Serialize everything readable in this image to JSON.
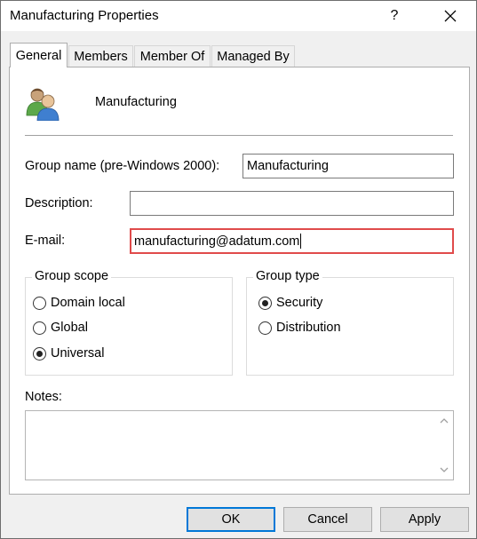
{
  "window": {
    "title": "Manufacturing Properties",
    "help_label": "?"
  },
  "tabs": [
    {
      "label": "General",
      "active": true
    },
    {
      "label": "Members",
      "active": false
    },
    {
      "label": "Member Of",
      "active": false
    },
    {
      "label": "Managed By",
      "active": false
    }
  ],
  "general": {
    "group_display_name": "Manufacturing",
    "group_icon": "group-users-icon",
    "group_name_label": "Group name (pre-Windows 2000):",
    "group_name_value": "Manufacturing",
    "description_label": "Description:",
    "description_value": "",
    "email_label": "E-mail:",
    "email_value": "manufacturing@adatum.com",
    "group_scope": {
      "title": "Group scope",
      "options": [
        "Domain local",
        "Global",
        "Universal"
      ],
      "selected": "Universal"
    },
    "group_type": {
      "title": "Group type",
      "options": [
        "Security",
        "Distribution"
      ],
      "selected": "Security"
    },
    "notes_label": "Notes:",
    "notes_value": ""
  },
  "buttons": {
    "ok": "OK",
    "cancel": "Cancel",
    "apply": "Apply"
  },
  "colors": {
    "focus_highlight": "#e04b4b",
    "default_button_border": "#0078d7"
  }
}
